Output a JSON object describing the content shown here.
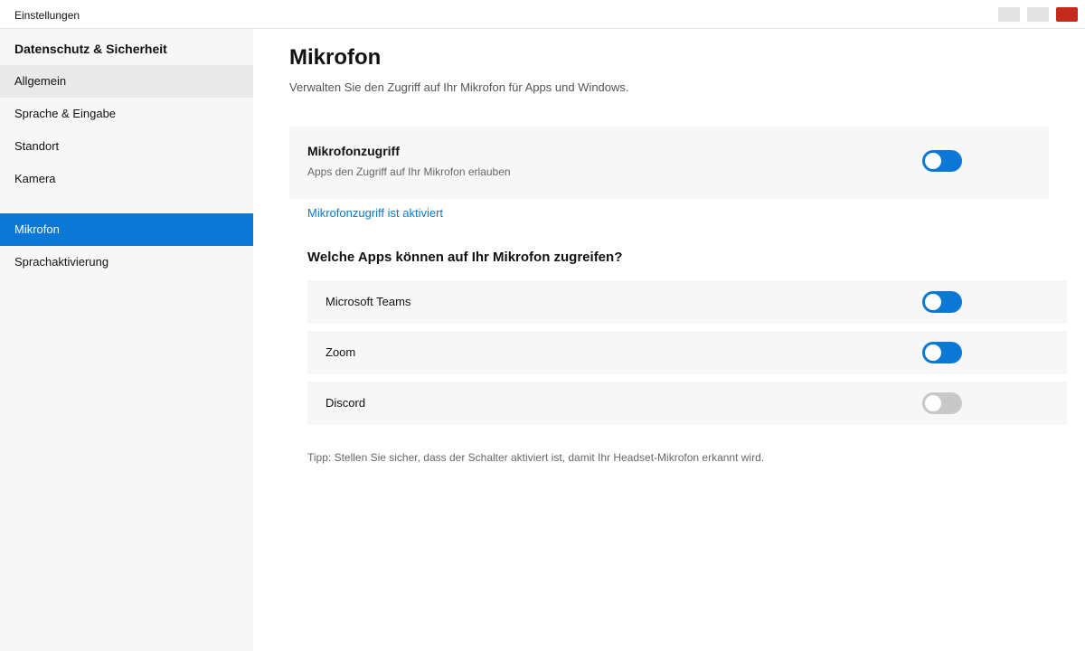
{
  "window": {
    "title": "Einstellungen"
  },
  "sidebar": {
    "heading": "Datenschutz & Sicherheit",
    "items": [
      {
        "label": "Allgemein"
      },
      {
        "label": "Sprache & Eingabe"
      },
      {
        "label": "Standort"
      },
      {
        "label": "Kamera"
      },
      {
        "label": "Mikrofon"
      },
      {
        "label": "Sprachaktivierung"
      }
    ],
    "active_item": "Mikrofon"
  },
  "main": {
    "title": "Mikrofon",
    "subtitle": "Verwalten Sie den Zugriff auf Ihr Mikrofon für Apps und Windows.",
    "access_card": {
      "title": "Mikrofonzugriff",
      "description": "Apps den Zugriff auf Ihr Mikrofon erlauben",
      "enabled": true
    },
    "status_link": "Mikrofonzugriff ist aktiviert",
    "apps_heading": "Welche Apps können auf Ihr Mikrofon zugreifen?",
    "apps": [
      {
        "name": "Microsoft Teams",
        "enabled": true
      },
      {
        "name": "Zoom",
        "enabled": true
      },
      {
        "name": "Discord",
        "enabled": false
      }
    ],
    "tip": "Tipp: Stellen Sie sicher, dass der Schalter aktiviert ist, damit Ihr Headset-Mikrofon erkannt wird."
  },
  "colors": {
    "accent": "#0a78d4",
    "toggle_off": "#c8c8c8",
    "close_button": "#c42b1c"
  }
}
